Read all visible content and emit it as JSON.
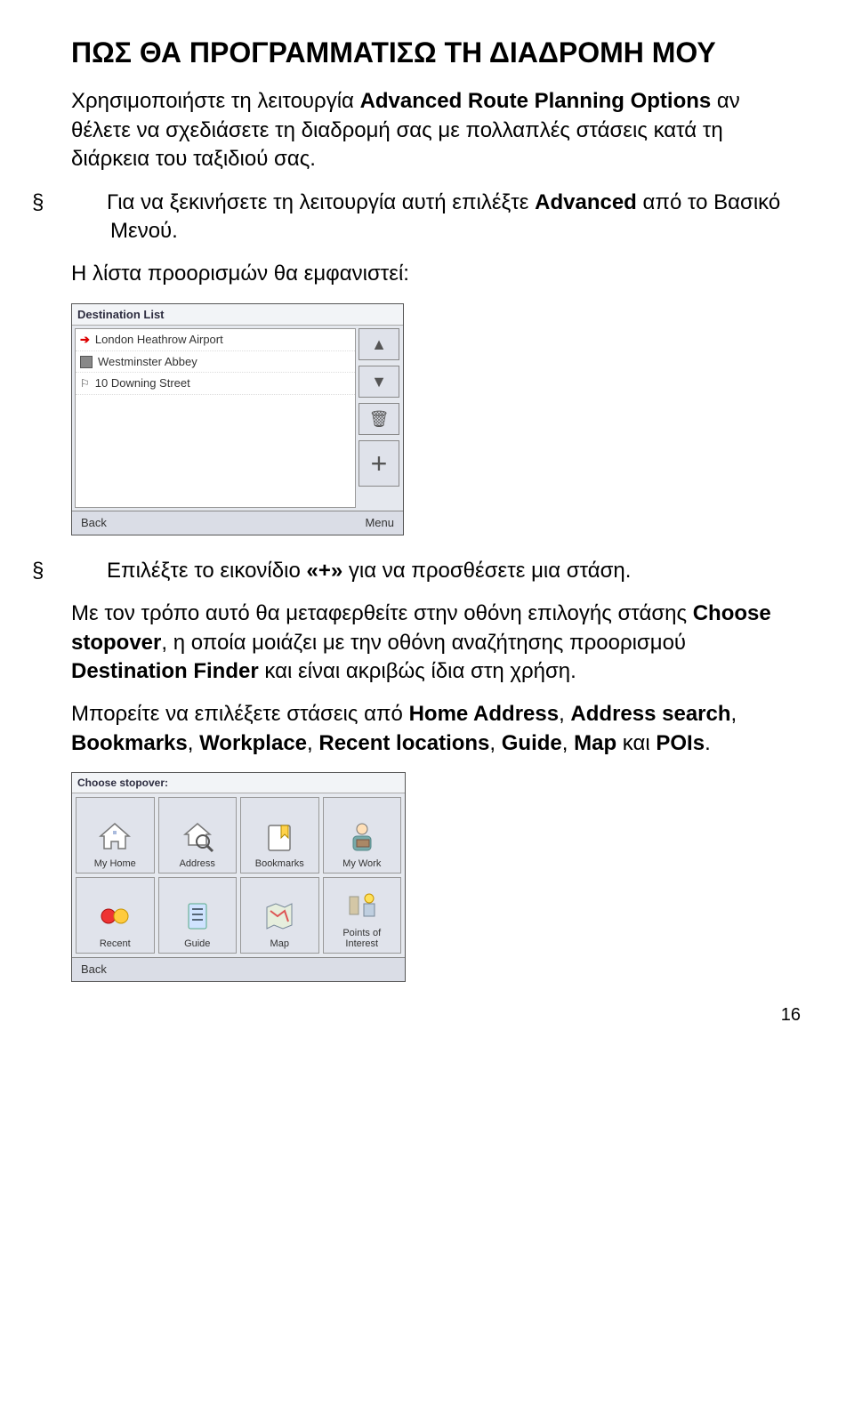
{
  "heading": "ΠΩΣ ΘΑ ΠΡΟΓΡΑΜΜΑΤΙΣΩ ΤΗ ΔΙΑΔΡΟΜΗ ΜΟΥ",
  "intro_pre": "Χρησιμοποιήστε τη λειτουργία ",
  "intro_bold": "Advanced Route Planning Options",
  "intro_post": " αν θέλετε να σχεδιάσετε τη διαδρομή σας με πολλαπλές στάσεις κατά τη διάρκεια του ταξιδιού σας.",
  "bullet1_pre": "Για να ξεκινήσετε τη λειτουργία αυτή επιλέξτε ",
  "bullet1_bold": "Advanced",
  "bullet1_post": " από το Βασικό Μενού.",
  "list_label": "Η λίστα προορισμών θα εμφανιστεί:",
  "dest": {
    "title": "Destination List",
    "items": {
      "0": "London Heathrow Airport",
      "1": "Westminster Abbey",
      "2": "10 Downing Street"
    },
    "back": "Back",
    "menu": "Menu"
  },
  "bullet2_pre": "Επιλέξτε το εικονίδιο ",
  "bullet2_bold": "«+»",
  "bullet2_post": "  για να προσθέσετε μια στάση.",
  "para3_pre": "Με τον τρόπο αυτό θα μεταφερθείτε στην οθόνη επιλογής στάσης ",
  "para3_b1": "Choose stopover",
  "para3_mid": ", η οποία μοιάζει με την οθόνη αναζήτησης προορισμού ",
  "para3_b2": "Destination Finder",
  "para3_post": " και είναι ακριβώς ίδια στη χρήση.",
  "para4_pre": "Μπορείτε να επιλέξετε στάσεις από ",
  "para4_b1": "Home Address",
  "para4_sep1": ", ",
  "para4_b2": "Address search",
  "para4_sep2": ", ",
  "para4_b3": "Bookmarks",
  "para4_sep3": ", ",
  "para4_b4": "Workplace",
  "para4_sep4": ", ",
  "para4_b5": "Recent locations",
  "para4_sep5": ", ",
  "para4_b6": "Guide",
  "para4_sep6": ", ",
  "para4_b7": "Map",
  "para4_sep7": " και ",
  "para4_b8": "POIs",
  "para4_post": ".",
  "stop": {
    "title": "Choose stopover:",
    "back": "Back",
    "cells": {
      "0": "My Home",
      "1": "Address",
      "2": "Bookmarks",
      "3": "My Work",
      "4": "Recent",
      "5": "Guide",
      "6": "Map",
      "7": "Points of Interest"
    }
  },
  "page_number": "16",
  "symbol": "§"
}
